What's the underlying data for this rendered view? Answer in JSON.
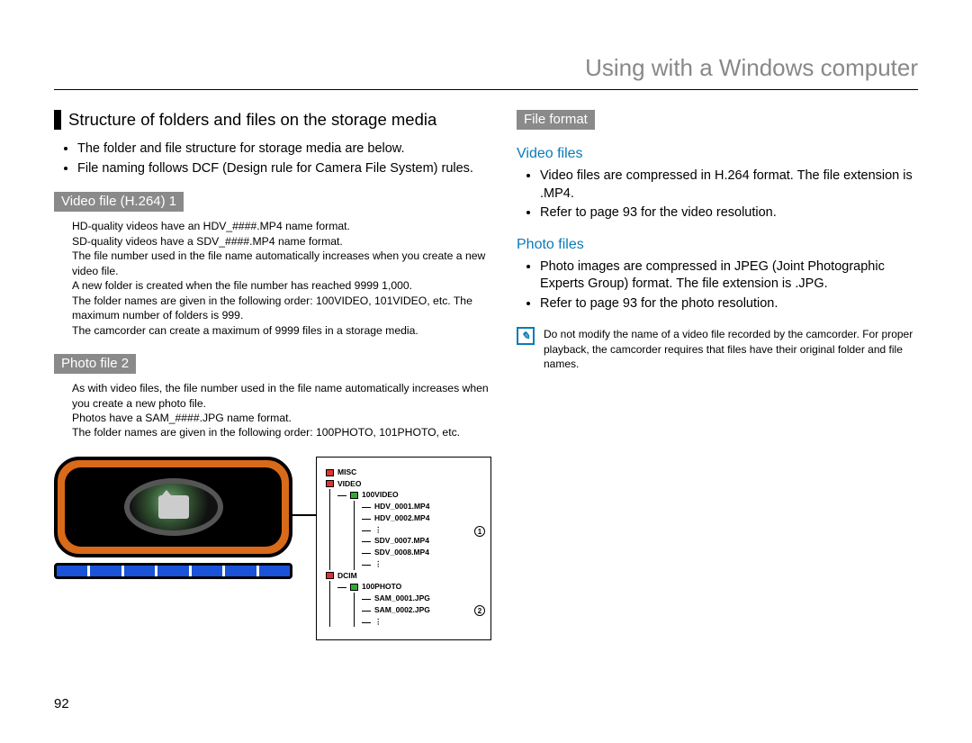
{
  "pageTitle": "Using with a Windows computer",
  "pageNumber": "92",
  "left": {
    "heading": "Structure of folders and files on the storage media",
    "intro": [
      "The folder and file structure for storage media are below.",
      "File naming follows DCF (Design rule for Camera File System) rules."
    ],
    "video": {
      "tag": "Video file (H.264) 1",
      "lines": [
        "HD-quality videos have an HDV_####.MP4 name format.",
        "SD-quality videos have a SDV_####.MP4 name format.",
        "The file number used in the file name automatically increases when you create a new video file.",
        "A new folder is created when the file number has reached 9999 1,000.",
        "The folder names are given in the following order: 100VIDEO, 101VIDEO, etc. The maximum number of folders is 999.",
        "The camcorder can create a maximum of 9999 files in a storage media."
      ]
    },
    "photo": {
      "tag": "Photo file 2",
      "lines": [
        "As with video files, the file number used in the file name automatically increases when you create a new photo file.",
        "Photos have a SAM_####.JPG name format.",
        "The folder names are given in the following order: 100PHOTO, 101PHOTO, etc."
      ]
    },
    "tree": {
      "misc": "MISC",
      "video": "VIDEO",
      "v100": "100VIDEO",
      "hdv1": "HDV_0001.MP4",
      "hdv2": "HDV_0002.MP4",
      "sdv7": "SDV_0007.MP4",
      "sdv8": "SDV_0008.MP4",
      "dcim": "DCIM",
      "p100": "100PHOTO",
      "sam1": "SAM_0001.JPG",
      "sam2": "SAM_0002.JPG",
      "mark1": "1",
      "mark2": "2"
    }
  },
  "right": {
    "fileFormat": "File format",
    "videoFilesTitle": "Video files",
    "videoFilesBullets": [
      "Video files are compressed in H.264 format. The file extension is .MP4.",
      "Refer to page 93 for the video resolution."
    ],
    "photoFilesTitle": "Photo files",
    "photoFilesBullets": [
      "Photo images are compressed in JPEG (Joint Photographic Experts Group) format. The file extension is .JPG.",
      "Refer to page 93 for the photo resolution."
    ],
    "noteText": "Do not modify the name of a video file recorded by the camcorder. For proper playback, the camcorder requires that files have their original folder and file names."
  }
}
